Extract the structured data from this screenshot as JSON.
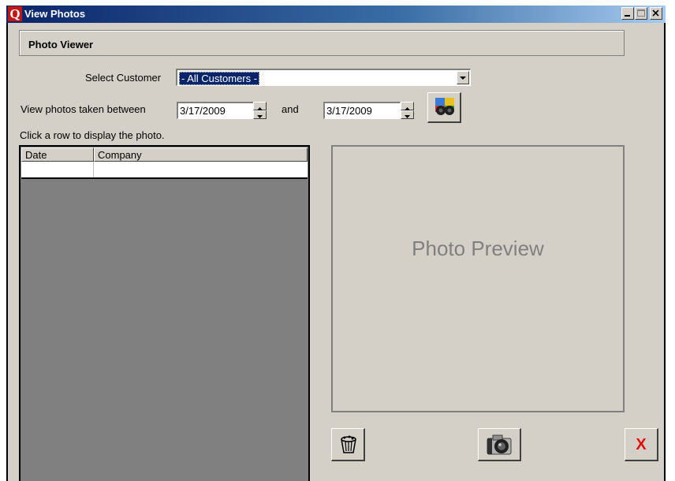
{
  "window": {
    "title": "View Photos",
    "app_icon_letter": "Q",
    "controls": [
      "minimize-icon",
      "maximize-icon",
      "close-icon"
    ]
  },
  "header": {
    "title": "Photo Viewer"
  },
  "filters": {
    "customer_label": "Select Customer",
    "customer_value": "- All Customers -",
    "date_label": "View photos taken between",
    "date_from": "3/17/2009",
    "and_label": "and",
    "date_to": "3/17/2009",
    "search_icon": "binoculars-icon"
  },
  "grid": {
    "hint": "Click a row to display the photo.",
    "columns": [
      "Date",
      "Company"
    ],
    "rows": [
      [
        "",
        ""
      ]
    ]
  },
  "preview": {
    "placeholder": "Photo Preview"
  },
  "actions": {
    "delete_icon": "trash-icon",
    "camera_icon": "camera-icon",
    "close_label": "X"
  },
  "colors": {
    "titlebar_start": "#0a246a",
    "titlebar_end": "#a6caf0",
    "face": "#d4d0c8",
    "grid_bg": "#808080",
    "close_red": "#e01010",
    "app_icon_red": "#c01818"
  }
}
